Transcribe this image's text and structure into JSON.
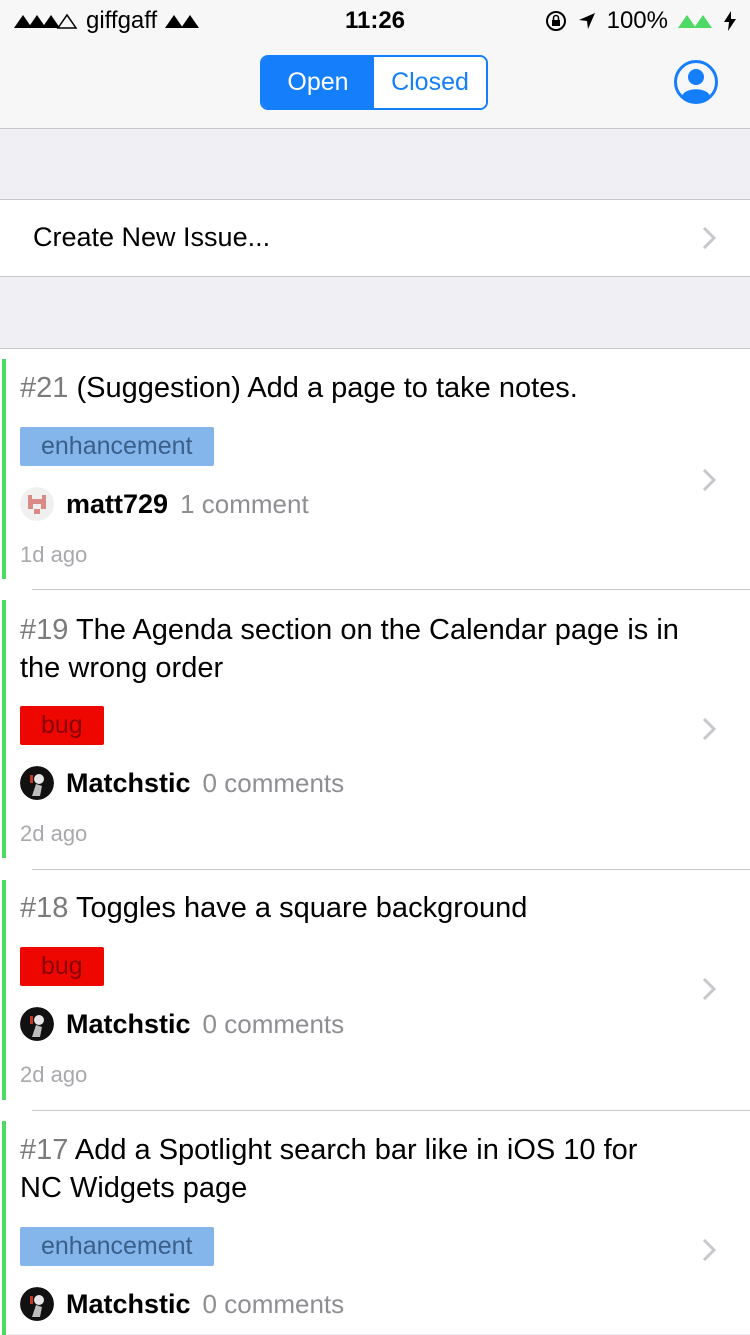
{
  "status_bar": {
    "carrier": "giffgaff",
    "time": "11:26",
    "battery": "100%"
  },
  "nav": {
    "segment_open": "Open",
    "segment_closed": "Closed",
    "active_segment": "Open",
    "profile_icon": "person-circle-icon"
  },
  "create_issue": {
    "label": "Create New Issue..."
  },
  "issues": [
    {
      "number": "#21",
      "title": "(Suggestion) Add a page to take notes.",
      "label": "enhancement",
      "label_color": "#84b6eb",
      "author": "matt729",
      "comments": "1 comment",
      "age": "1d ago",
      "status_color": "#4cd964"
    },
    {
      "number": "#19",
      "title": "The Agenda section on the Calendar page is in the wrong order",
      "label": "bug",
      "label_color": "#ee0701",
      "author": "Matchstic",
      "comments": "0 comments",
      "age": "2d ago",
      "status_color": "#4cd964"
    },
    {
      "number": "#18",
      "title": "Toggles have a square background",
      "label": "bug",
      "label_color": "#ee0701",
      "author": "Matchstic",
      "comments": "0 comments",
      "age": "2d ago",
      "status_color": "#4cd964"
    },
    {
      "number": "#17",
      "title": "Add a Spotlight search bar like in iOS 10 for NC Widgets page",
      "label": "enhancement",
      "label_color": "#84b6eb",
      "author": "Matchstic",
      "comments": "0 comments",
      "age": "",
      "status_color": "#4cd964"
    }
  ],
  "colors": {
    "accent": "#157efb",
    "open_status": "#4cd964",
    "background": "#efeff4"
  }
}
